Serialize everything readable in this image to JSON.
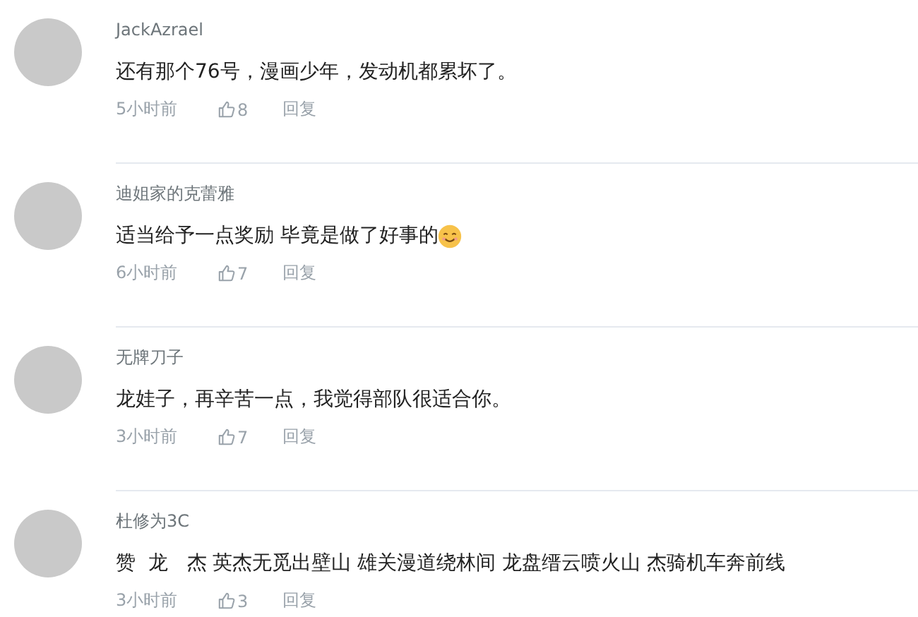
{
  "comments": [
    {
      "user": "JackAzrael",
      "text": "还有那个76号，漫画少年，发动机都累坏了。",
      "emoji": false,
      "time": "5小时前",
      "likes": "8",
      "reply": "回复"
    },
    {
      "user": "迪姐家的克蕾雅",
      "text": "适当给予一点奖励 毕竟是做了好事的",
      "emoji": true,
      "time": "6小时前",
      "likes": "7",
      "reply": "回复"
    },
    {
      "user": "无牌刀子",
      "text": "龙娃子，再辛苦一点，我觉得部队很适合你。",
      "emoji": false,
      "time": "3小时前",
      "likes": "7",
      "reply": "回复"
    },
    {
      "user": "杜修为3C",
      "text": "赞  龙   杰 英杰无觅出壁山 雄关漫道绕林间 龙盘缙云喷火山 杰骑机车奔前线",
      "emoji": false,
      "time": "3小时前",
      "likes": "3",
      "reply": "回复"
    }
  ]
}
